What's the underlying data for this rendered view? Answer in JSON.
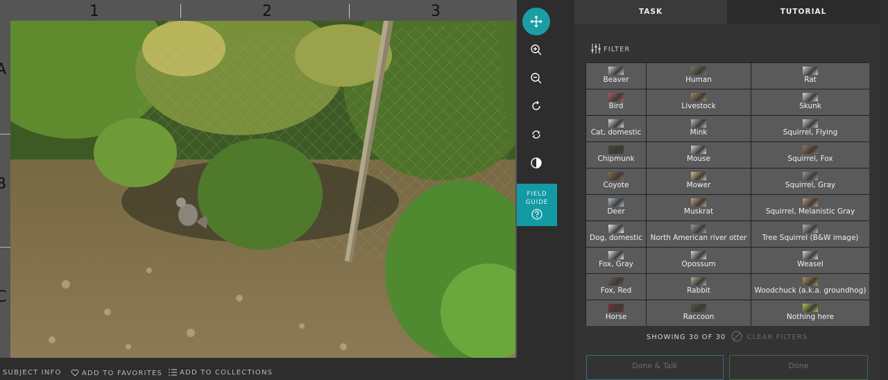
{
  "viewer": {
    "column_labels": [
      "1",
      "2",
      "3"
    ],
    "row_labels": [
      "A",
      "B",
      "C"
    ],
    "image_description_icon": "trail-camera-photo"
  },
  "toolbar": {
    "tools": [
      {
        "icon": "move-icon",
        "active": true
      },
      {
        "icon": "zoom-in-icon",
        "active": false
      },
      {
        "icon": "zoom-out-icon",
        "active": false
      },
      {
        "icon": "rotate-icon",
        "active": false
      },
      {
        "icon": "reset-icon",
        "active": false
      },
      {
        "icon": "invert-icon",
        "active": false
      }
    ],
    "field_guide_line1": "FIELD",
    "field_guide_line2": "GUIDE"
  },
  "bottom_bar": {
    "subject_info": "SUBJECT INFO",
    "add_to_favorites": "ADD TO FAVORITES",
    "add_to_collections": "ADD TO COLLECTIONS"
  },
  "panel": {
    "tabs": {
      "task": "TASK",
      "tutorial": "TUTORIAL"
    },
    "filter_label": "FILTER",
    "choices": [
      "Beaver",
      "Human",
      "Rat",
      "Bird",
      "Livestock",
      "Skunk",
      "Cat, domestic",
      "Mink",
      "Squirrel, Flying",
      "Chipmunk",
      "Mouse",
      "Squirrel, Fox",
      "Coyote",
      "Mower",
      "Squirrel, Gray",
      "Deer",
      "Muskrat",
      "Squirrel, Melanistic Gray",
      "Dog, domestic",
      "North American river otter",
      "Tree Squirrel (B&W image)",
      "Fox, Gray",
      "Opossum",
      "Weasel",
      "Fox, Red",
      "Rabbit",
      "Woodchuck (a.k.a. groundhog)",
      "Horse",
      "Raccoon",
      "Nothing here"
    ],
    "thumb_colors": [
      "#cfcfcf",
      "#6f7f55",
      "#d4d4d4",
      "#b4585d",
      "#a98a54",
      "#dcdcdc",
      "#e0e0e0",
      "#bdbdbd",
      "#d2d2d2",
      "#3f4a2c",
      "#d8d8d8",
      "#a0724e",
      "#8c6e46",
      "#d7c38e",
      "#9a9a9a",
      "#b6c0c8",
      "#c9a27a",
      "#c9996a",
      "#efefef",
      "#9c9c9c",
      "#b9b9b9",
      "#e2e2e2",
      "#cfd6de",
      "#dadada",
      "#6a5b4a",
      "#a7b592",
      "#b89250",
      "#7a2e2e",
      "#4d5a40",
      "#b9c14c"
    ],
    "showing_text": "SHOWING 30 OF 30",
    "clear_filters": "CLEAR FILTERS",
    "done_talk": "Done & Talk",
    "done": "Done"
  },
  "colors": {
    "accent": "#139aa2",
    "panel_bg": "#333333",
    "choice_bg": "#5a5a5a"
  }
}
